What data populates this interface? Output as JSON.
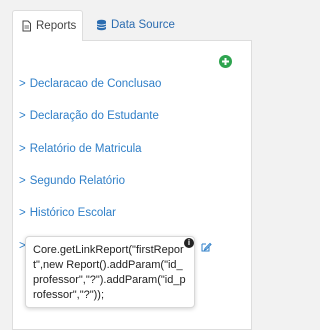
{
  "tabs": {
    "reports_label": "Reports",
    "data_source_label": "Data Source"
  },
  "reports": {
    "items": [
      {
        "label": "Declaracao de Conclusao"
      },
      {
        "label": "Declaração do Estudante"
      },
      {
        "label": "Relatório de Matricula"
      },
      {
        "label": "Segundo Relatório"
      },
      {
        "label": "Histórico Escolar"
      }
    ],
    "hidden_item_chevron": ">"
  },
  "tooltip": {
    "text": "Core.getLinkReport(\"firstReport\",new Report().addParam(\"id_professor\",\"?\").addParam(\"id_professor\",\"?\"));"
  },
  "colors": {
    "link": "#2f7fc8",
    "add": "#2ea44f",
    "data_source": "#2b6cb0"
  },
  "icons": {
    "reports_tab": "file-icon",
    "data_source_tab": "database-icon",
    "add": "plus-circle-icon",
    "edit": "edit-icon",
    "info": "info-icon"
  }
}
